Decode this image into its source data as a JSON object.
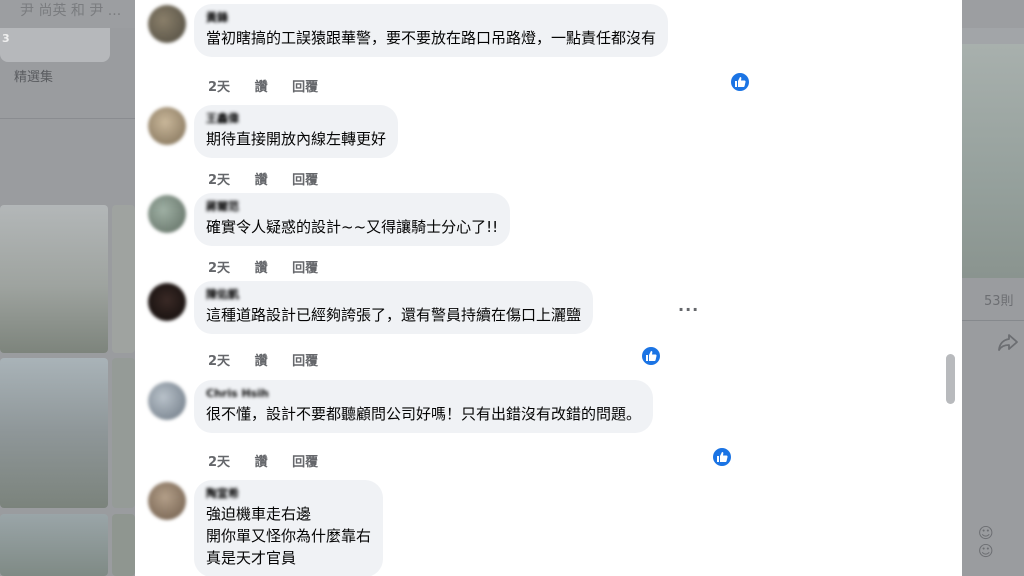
{
  "background": {
    "tab_text": "尹 尚英 和 尹 ...",
    "photo_count": "3",
    "featured_label": "精選集",
    "likes_count": "53則"
  },
  "comments": [
    {
      "author": "黃鋒",
      "text": [
        "當初瞎搞的工誤猿跟華警，要不要放在路口吊路燈，一點責任都沒有"
      ],
      "time": "2天",
      "like": "讚",
      "reply": "回覆",
      "liked": true
    },
    {
      "author": "王鑫偉",
      "text": [
        "期待直接開放內線左轉更好"
      ],
      "time": "2天",
      "like": "讚",
      "reply": "回覆",
      "liked": false
    },
    {
      "author": "蔣爾范",
      "text": [
        "確實令人疑惑的設計~~又得讓騎士分心了!!"
      ],
      "time": "2天",
      "like": "讚",
      "reply": "回覆",
      "liked": false
    },
    {
      "author": "陳佑凱",
      "text": [
        "這種道路設計已經夠誇張了，還有警員持續在傷口上灑鹽"
      ],
      "time": "2天",
      "like": "讚",
      "reply": "回覆",
      "liked": true,
      "more": "···"
    },
    {
      "author": "Chris Hsih",
      "text": [
        "很不懂，設計不要都聽顧問公司好嗎！只有出錯沒有改錯的問題。"
      ],
      "time": "2天",
      "like": "讚",
      "reply": "回覆",
      "liked": true
    },
    {
      "author": "陶宣希",
      "text": [
        "強迫機車走右邊",
        "開你單又怪你為什麼靠右",
        "真是天才官員"
      ],
      "time": "",
      "like": "",
      "reply": "",
      "liked": false
    }
  ],
  "colors": {
    "like_blue": "#1b74e4",
    "bubble_bg": "#f0f2f5",
    "overlay_gray": "#9a9c9f"
  },
  "icons": [
    "thumbs-up-icon",
    "more-options-icon",
    "share-icon",
    "emoji-icon"
  ]
}
